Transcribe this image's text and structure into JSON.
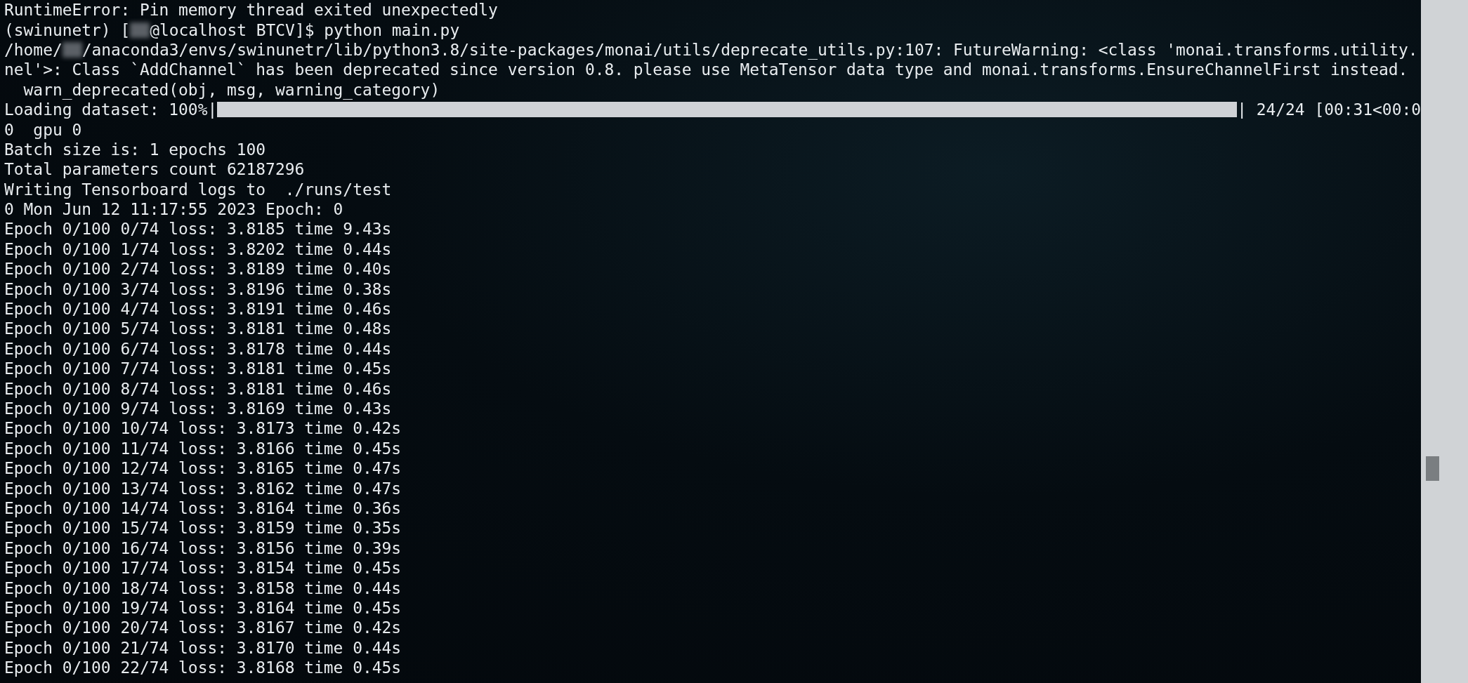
{
  "terminal": {
    "lines": [
      {
        "kind": "text",
        "text": "RuntimeError: Pin memory thread exited unexpectedly"
      },
      {
        "kind": "redacted",
        "before": "(swinunetr) [",
        "after": "@localhost BTCV]$ python main.py"
      },
      {
        "kind": "redacted",
        "before": "/home/",
        "after": "/anaconda3/envs/swinunetr/lib/python3.8/site-packages/monai/utils/deprecate_utils.py:107: FutureWarning: <class 'monai.transforms.utility."
      },
      {
        "kind": "text",
        "text": "nel'>: Class `AddChannel` has been deprecated since version 0.8. please use MetaTensor data type and monai.transforms.EnsureChannelFirst instead."
      },
      {
        "kind": "text",
        "text": "  warn_deprecated(obj, msg, warning_category)"
      },
      {
        "kind": "progress",
        "label": "Loading dataset: 100%|",
        "level": 1,
        "suffix": "| 24/24 [00:31<00:0"
      },
      {
        "kind": "text",
        "text": "0  gpu 0"
      },
      {
        "kind": "text",
        "text": "Batch size is: 1 epochs 100"
      },
      {
        "kind": "text",
        "text": "Total parameters count 62187296"
      },
      {
        "kind": "text",
        "text": "Writing Tensorboard logs to  ./runs/test"
      },
      {
        "kind": "text",
        "text": "0 Mon Jun 12 11:17:55 2023 Epoch: 0"
      },
      {
        "kind": "text",
        "text": "Epoch 0/100 0/74 loss: 3.8185 time 9.43s"
      },
      {
        "kind": "text",
        "text": "Epoch 0/100 1/74 loss: 3.8202 time 0.44s"
      },
      {
        "kind": "text",
        "text": "Epoch 0/100 2/74 loss: 3.8189 time 0.40s"
      },
      {
        "kind": "text",
        "text": "Epoch 0/100 3/74 loss: 3.8196 time 0.38s"
      },
      {
        "kind": "text",
        "text": "Epoch 0/100 4/74 loss: 3.8191 time 0.46s"
      },
      {
        "kind": "text",
        "text": "Epoch 0/100 5/74 loss: 3.8181 time 0.48s"
      },
      {
        "kind": "text",
        "text": "Epoch 0/100 6/74 loss: 3.8178 time 0.44s"
      },
      {
        "kind": "text",
        "text": "Epoch 0/100 7/74 loss: 3.8181 time 0.45s"
      },
      {
        "kind": "text",
        "text": "Epoch 0/100 8/74 loss: 3.8181 time 0.46s"
      },
      {
        "kind": "text",
        "text": "Epoch 0/100 9/74 loss: 3.8169 time 0.43s"
      },
      {
        "kind": "text",
        "text": "Epoch 0/100 10/74 loss: 3.8173 time 0.42s"
      },
      {
        "kind": "text",
        "text": "Epoch 0/100 11/74 loss: 3.8166 time 0.45s"
      },
      {
        "kind": "text",
        "text": "Epoch 0/100 12/74 loss: 3.8165 time 0.47s"
      },
      {
        "kind": "text",
        "text": "Epoch 0/100 13/74 loss: 3.8162 time 0.47s"
      },
      {
        "kind": "text",
        "text": "Epoch 0/100 14/74 loss: 3.8164 time 0.36s"
      },
      {
        "kind": "text",
        "text": "Epoch 0/100 15/74 loss: 3.8159 time 0.35s"
      },
      {
        "kind": "text",
        "text": "Epoch 0/100 16/74 loss: 3.8156 time 0.39s"
      },
      {
        "kind": "text",
        "text": "Epoch 0/100 17/74 loss: 3.8154 time 0.45s"
      },
      {
        "kind": "text",
        "text": "Epoch 0/100 18/74 loss: 3.8158 time 0.44s"
      },
      {
        "kind": "text",
        "text": "Epoch 0/100 19/74 loss: 3.8164 time 0.45s"
      },
      {
        "kind": "text",
        "text": "Epoch 0/100 20/74 loss: 3.8167 time 0.42s"
      },
      {
        "kind": "text",
        "text": "Epoch 0/100 21/74 loss: 3.8170 time 0.44s"
      },
      {
        "kind": "text",
        "text": "Epoch 0/100 22/74 loss: 3.8168 time 0.45s"
      }
    ]
  }
}
